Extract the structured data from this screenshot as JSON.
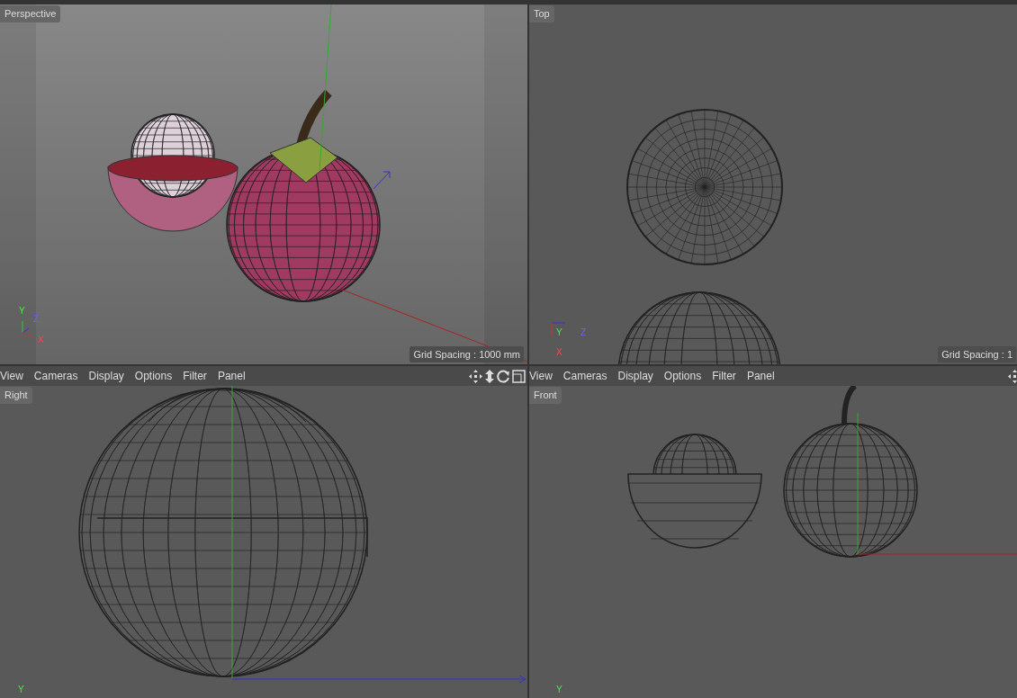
{
  "viewports": [
    {
      "kind": "perspective",
      "label": "Perspective",
      "grid_spacing": "Grid Spacing : 1000 mm",
      "axes": [
        "Y",
        "Z",
        "X"
      ]
    },
    {
      "kind": "top",
      "label": "Top",
      "grid_spacing": "Grid Spacing : 1",
      "axes": [
        "Y",
        "Z",
        "X"
      ]
    },
    {
      "kind": "right",
      "label": "Right",
      "menu": [
        "View",
        "Cameras",
        "Display",
        "Options",
        "Filter",
        "Panel"
      ],
      "axes": [
        "Y"
      ]
    },
    {
      "kind": "front",
      "label": "Front",
      "menu": [
        "View",
        "Cameras",
        "Display",
        "Options",
        "Filter",
        "Panel"
      ],
      "axes": [
        "Y"
      ]
    }
  ]
}
